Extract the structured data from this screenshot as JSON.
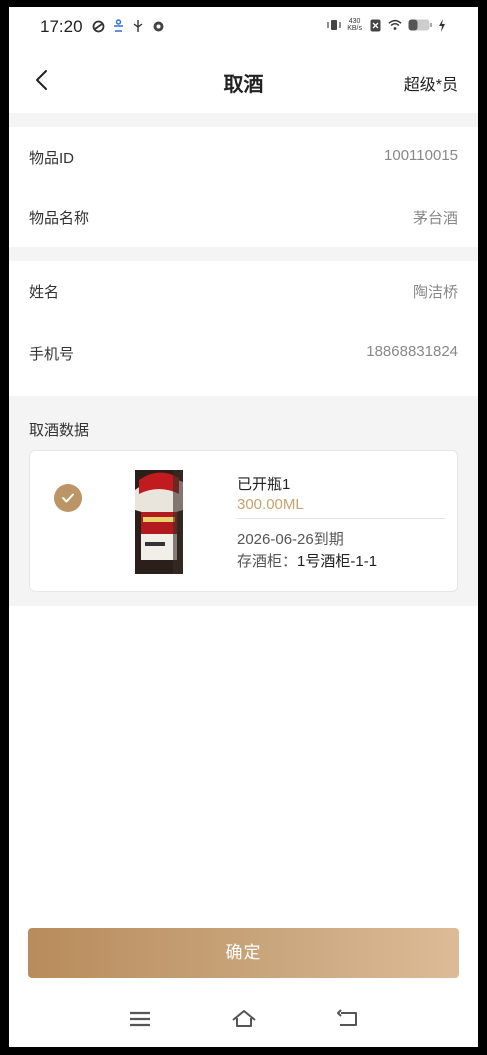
{
  "status_bar": {
    "time": "17:20",
    "speed_value": "430",
    "speed_unit": "KB/s",
    "icons_left": [
      "sync-icon",
      "accessibility-icon",
      "usb-icon",
      "settings-icon"
    ],
    "icons_right": [
      "vibrate-icon",
      "sim-off-icon",
      "wifi-icon",
      "battery-icon",
      "charging-icon"
    ]
  },
  "nav": {
    "back_icon": "chevron-left-icon",
    "title": "取酒",
    "user": "超级*员"
  },
  "item_info": {
    "id_label": "物品ID",
    "id_value": "100110015",
    "name_label": "物品名称",
    "name_value": "茅台酒"
  },
  "customer_info": {
    "name_label": "姓名",
    "name_value": "陶洁桥",
    "phone_label": "手机号",
    "phone_value": "18868831824"
  },
  "withdraw": {
    "section_title": "取酒数据",
    "card": {
      "selected": true,
      "status": "已开瓶1",
      "volume": "300.00ML",
      "expiry": "2026-06-26到期",
      "cabinet_label": "存酒柜：",
      "cabinet_value": "1号酒柜-1-1"
    }
  },
  "footer": {
    "confirm_label": "确定"
  },
  "system_nav": {
    "icons": [
      "menu-icon",
      "home-icon",
      "back-icon"
    ]
  },
  "colors": {
    "accent": "#bc9566",
    "volume_text": "#c5a46f",
    "button_gradient_start": "#b88c5c",
    "button_gradient_end": "#ddbb97",
    "gap_background": "#f4f4f4"
  }
}
